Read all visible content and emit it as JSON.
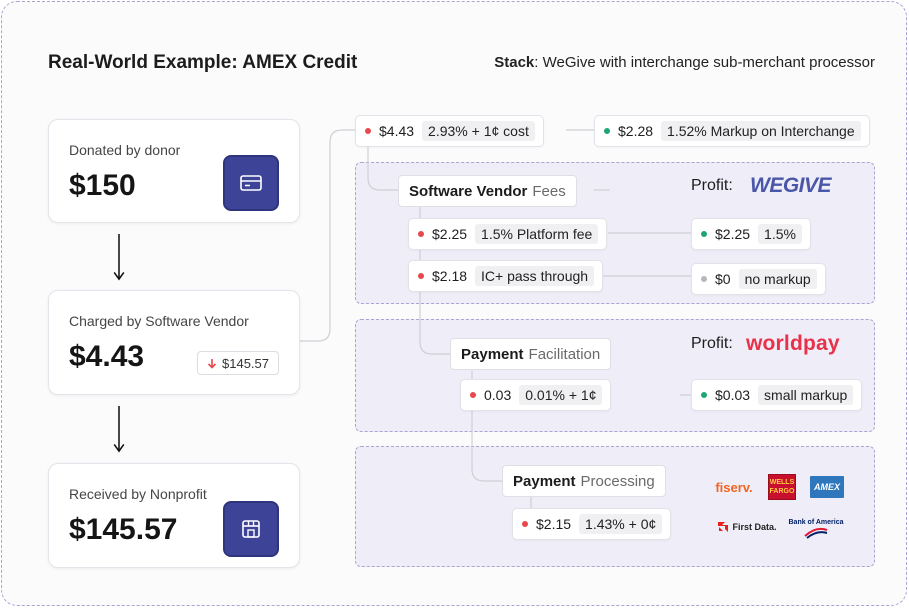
{
  "title": "Real-World Example: AMEX Credit",
  "stack": {
    "label": "Stack",
    "value": ": WeGive with interchange sub-merchant processor"
  },
  "cards": {
    "donated": {
      "label": "Donated by donor",
      "amount": "$150",
      "icon": "credit-card-icon"
    },
    "charged": {
      "label": "Charged by Software Vendor",
      "amount": "$4.43",
      "diff": "$145.57",
      "diff_icon": "arrow-down-icon"
    },
    "received": {
      "label": "Received by Nonprofit",
      "amount": "$145.57",
      "icon": "storefront-icon"
    }
  },
  "top_row": {
    "cost": {
      "value": "$4.43",
      "desc": "2.93% + 1¢ cost"
    },
    "markup": {
      "value": "$2.28",
      "desc": "1.52% Markup on Interchange"
    }
  },
  "software_vendor": {
    "title": "Software Vendor",
    "title_sub": "Fees",
    "profit_label": "Profit:",
    "logo": "WEGIVE",
    "rows": [
      {
        "value": "$2.25",
        "desc": "1.5% Platform fee",
        "profit_value": "$2.25",
        "profit_desc": "1.5%",
        "profit_color": "green"
      },
      {
        "value": "$2.18",
        "desc": "IC+ pass through",
        "profit_value": "$0",
        "profit_desc": "no markup",
        "profit_color": "gray"
      }
    ]
  },
  "payment_facilitation": {
    "title": "Payment",
    "title_sub": "Facilitation",
    "profit_label": "Profit:",
    "logo": "worldpay",
    "row": {
      "value": "0.03",
      "desc": "0.01% + 1¢",
      "profit_value": "$0.03",
      "profit_desc": "small markup"
    }
  },
  "payment_processing": {
    "title": "Payment",
    "title_sub": "Processing",
    "row": {
      "value": "$2.15",
      "desc": "1.43% + 0¢"
    },
    "logos": {
      "fiserv": "fiserv.",
      "wells_fargo_line1": "WELLS",
      "wells_fargo_line2": "FARGO",
      "amex": "AMEX",
      "first_data": "First Data.",
      "bank_of_america": "Bank of America"
    }
  },
  "colors": {
    "accent": "#3d4396",
    "red_dot": "#e5484d",
    "green_dot": "#1ea672",
    "region_bg": "#efedf7",
    "worldpay": "#e8324a",
    "wegive": "#4a56a8"
  }
}
